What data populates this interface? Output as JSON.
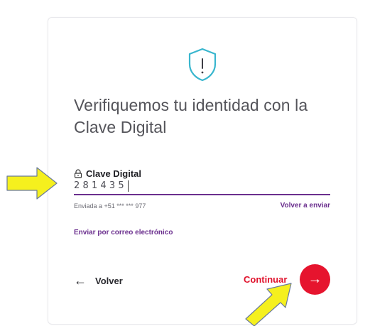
{
  "title": "Verifiquemos tu identidad con la Clave Digital",
  "field": {
    "label": "Clave Digital",
    "value": "281435"
  },
  "sent_to": "Enviada a +51 *** *** 977",
  "resend_label": "Volver a enviar",
  "email_link": "Enviar por correo electrónico",
  "back_label": "Volver",
  "back_arrow": "←",
  "continue_label": "Continuar",
  "continue_arrow": "→",
  "icons": {
    "shield": "shield-alert-icon",
    "lock": "lock-icon"
  },
  "colors": {
    "accent_purple": "#6b2f8e",
    "accent_red": "#e6142e",
    "annotation_yellow": "#f5f01e"
  }
}
